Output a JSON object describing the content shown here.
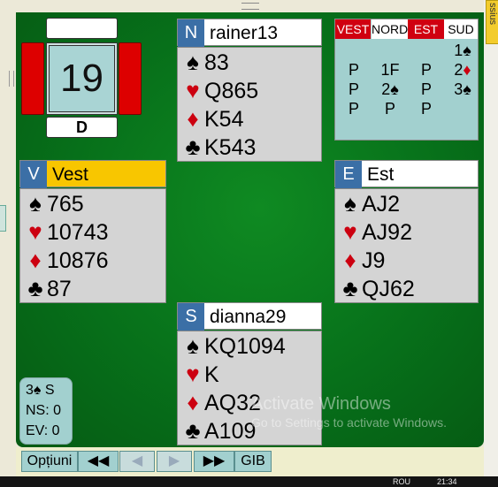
{
  "side_tab": "ssius",
  "board": {
    "number": "19",
    "dealer": "D"
  },
  "north": {
    "seat": "N",
    "name": "rainer13",
    "spades": "83",
    "hearts": "Q865",
    "diamonds": "K54",
    "clubs": "K543"
  },
  "west": {
    "seat": "V",
    "name": "Vest",
    "spades": "765",
    "hearts": "10743",
    "diamonds": "10876",
    "clubs": "87"
  },
  "east": {
    "seat": "E",
    "name": "Est",
    "spades": "AJ2",
    "hearts": "AJ92",
    "diamonds": "J9",
    "clubs": "QJ62"
  },
  "south": {
    "seat": "S",
    "name": "dianna29",
    "spades": "KQ1094",
    "hearts": "K",
    "diamonds": "AQ32",
    "clubs": "A109"
  },
  "suits": {
    "spade": "♠",
    "heart": "♥",
    "diamond": "♦",
    "club": "♣"
  },
  "auction": {
    "headers": [
      "VEST",
      "NORD",
      "EST",
      "SUD"
    ],
    "vulnerable": [
      true,
      false,
      true,
      false
    ],
    "rows": [
      [
        "",
        "",
        "",
        "1♠"
      ],
      [
        "P",
        "1F",
        "P",
        "2♦"
      ],
      [
        "P",
        "2♠",
        "P",
        "3♠"
      ],
      [
        "P",
        "P",
        "P",
        ""
      ]
    ]
  },
  "score": {
    "contract": "3♠ S",
    "ns": "NS: 0",
    "ev": "EV: 0"
  },
  "buttons": {
    "options": "Opțiuni",
    "first": "◀◀",
    "prev": "◀",
    "next": "▶",
    "last": "▶▶",
    "gib": "GIB"
  },
  "watermark": {
    "title": "Activate Windows",
    "subtitle": "Go to Settings to activate Windows."
  },
  "taskbar": {
    "lang": "ROU",
    "time": "21:34"
  },
  "colors": {
    "felt": "#0b7d1e",
    "vulnerable": "#d00010",
    "panel": "#a2d0cf",
    "seat": "#3b6fa6",
    "dealer_highlight": "#f8c600"
  }
}
